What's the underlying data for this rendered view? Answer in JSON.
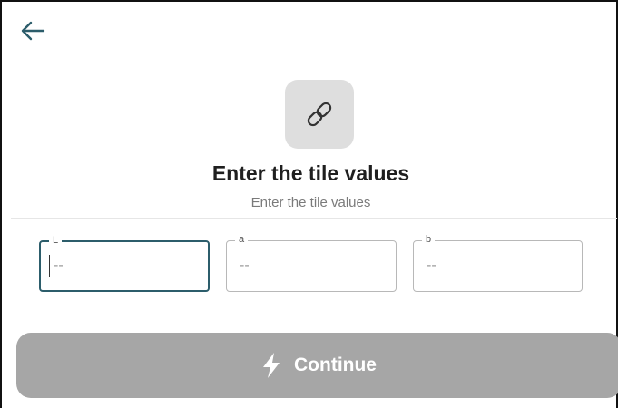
{
  "header": {
    "back_icon": "arrow-left-icon"
  },
  "hero": {
    "icon": "link-icon",
    "title": "Enter the tile values",
    "subtitle": "Enter the tile values"
  },
  "fields": [
    {
      "label": "L",
      "value": "--",
      "focused": true
    },
    {
      "label": "a",
      "value": "--",
      "focused": false
    },
    {
      "label": "b",
      "value": "--",
      "focused": false
    }
  ],
  "continue_button": {
    "label": "Continue",
    "icon": "lightning-icon",
    "enabled": false
  },
  "colors": {
    "accent": "#2c5d6b",
    "button_disabled": "#a6a6a6",
    "icon_tile": "#dedede"
  }
}
